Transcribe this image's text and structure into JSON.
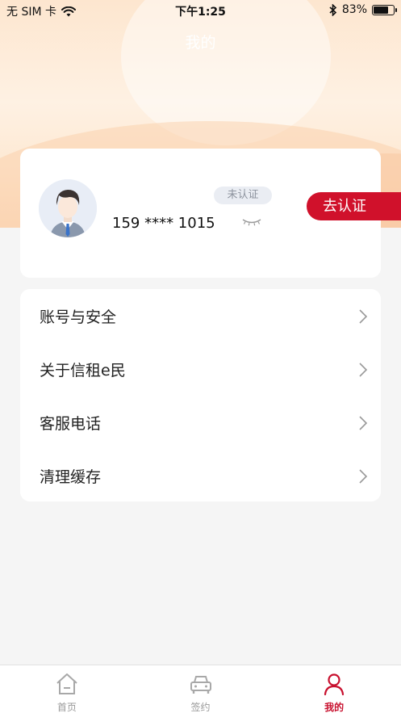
{
  "status_bar": {
    "carrier": "无 SIM 卡",
    "time": "下午1:25",
    "battery": "83%",
    "battery_level": 0.83
  },
  "header": {
    "title": "我的"
  },
  "profile": {
    "phone": "159 **** 1015",
    "status_badge": "未认证",
    "verify_button": "去认证",
    "avatar_icon": "user-avatar-icon",
    "toggle_icon": "eye-closed-icon"
  },
  "menu": {
    "items": [
      {
        "label": "账号与安全",
        "icon": "chevron-right-icon"
      },
      {
        "label": "关于信租e民",
        "icon": "chevron-right-icon"
      },
      {
        "label": "客服电话",
        "icon": "chevron-right-icon"
      },
      {
        "label": "清理缓存",
        "icon": "chevron-right-icon"
      }
    ]
  },
  "tab_bar": {
    "tabs": [
      {
        "label": "首页",
        "icon": "home-icon",
        "active": false
      },
      {
        "label": "签约",
        "icon": "car-icon",
        "active": false
      },
      {
        "label": "我的",
        "icon": "person-icon",
        "active": true
      }
    ]
  },
  "colors": {
    "accent": "#d0112b",
    "header_bg": "#fde6cf",
    "page_bg": "#f5f5f5"
  }
}
